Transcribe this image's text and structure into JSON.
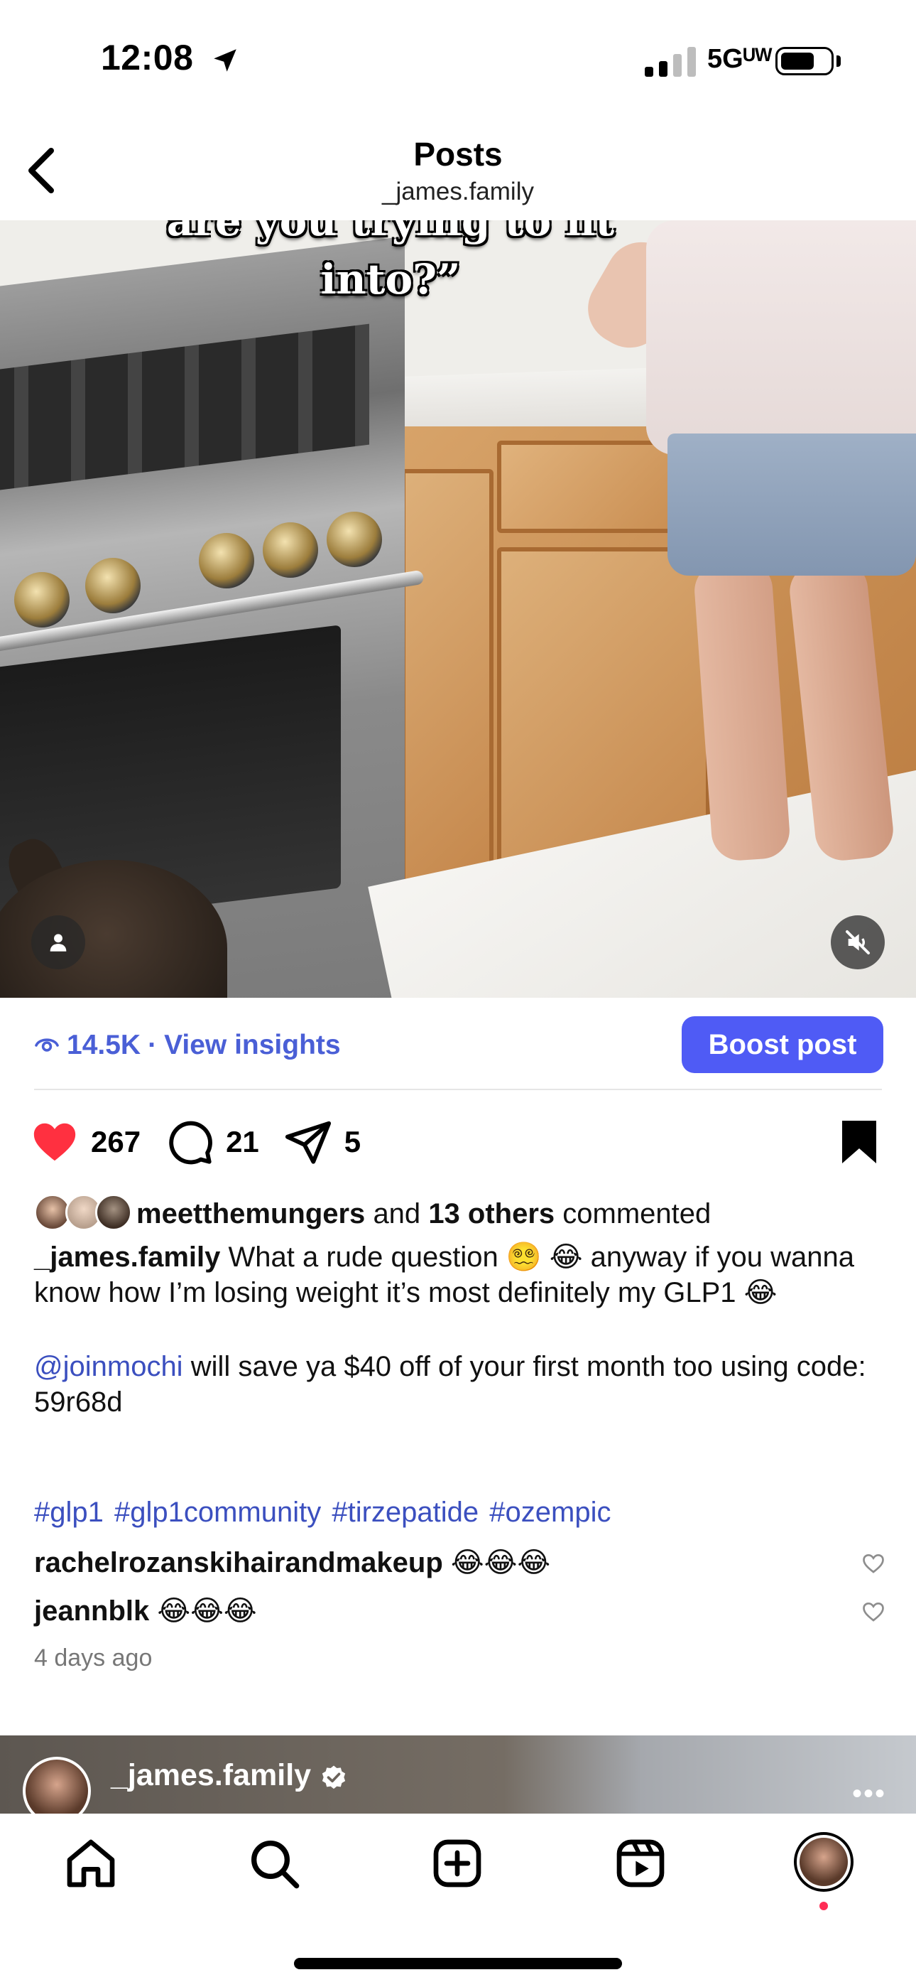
{
  "status_bar": {
    "time": "12:08",
    "network": "5Gᵁᵂ"
  },
  "header": {
    "title": "Posts",
    "subtitle": "_james.family"
  },
  "video": {
    "overlay_text": "are you trying to fit into?”"
  },
  "insights": {
    "views": "14.5K",
    "separator": "·",
    "link_label": "View insights",
    "boost_label": "Boost post"
  },
  "actions": {
    "likes": "267",
    "comments": "21",
    "shares": "5"
  },
  "comments_summary": {
    "first_user": "meetthemungers",
    "and_text": "and",
    "others": "13 others",
    "commented_text": "commented"
  },
  "caption": {
    "username": "_james.family",
    "line1": "What a rude question 😵‍💫 😂 anyway if you wanna know how I’m losing weight it’s most definitely my GLP1 😂",
    "mention": "@joinmochi",
    "line2": " will save ya $40 off of your first month too using code: 59r68d",
    "hashtags": "#glp1 #glp1community #tirzepatide #ozempic"
  },
  "comments": [
    {
      "user": "rachelrozanskihairandmakeup",
      "text": "😂😂😂"
    },
    {
      "user": "jeannblk",
      "text": "😂😂😂"
    }
  ],
  "time_ago": "4 days ago",
  "next_post": {
    "username": "_james.family",
    "more": "•••"
  },
  "colors": {
    "accent_blue": "#4f5bf5",
    "link_blue": "#3b4fbf",
    "like_red": "#ff3040"
  },
  "icons": {
    "tabs": [
      "home-icon",
      "search-icon",
      "create-icon",
      "reels-icon",
      "profile-avatar"
    ]
  }
}
